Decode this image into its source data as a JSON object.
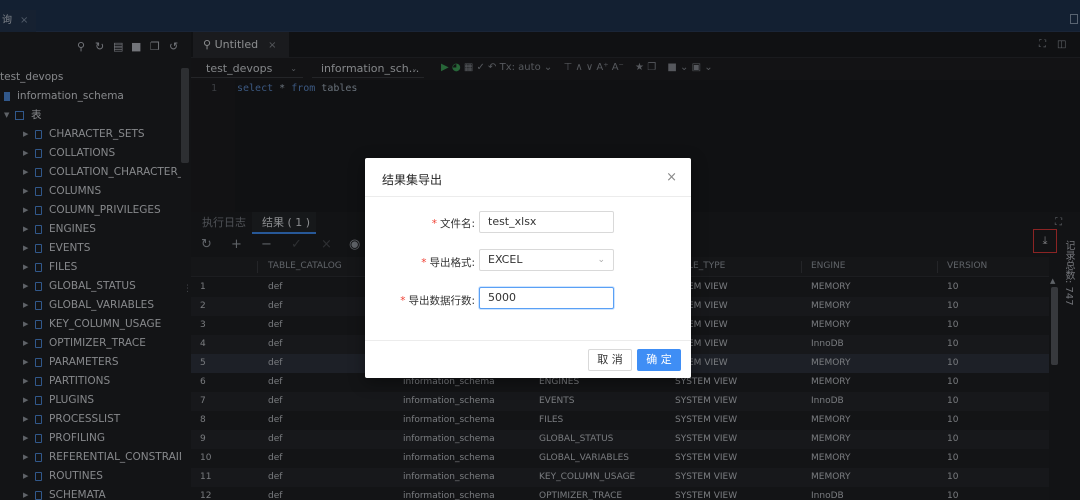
{
  "window": {
    "tab_label": "询",
    "tab_close": "×"
  },
  "sidebar": {
    "toolbar_icons": [
      "search-icon",
      "refresh-icon",
      "list-icon",
      "folder-icon",
      "copy-icon",
      "sync-icon"
    ],
    "database": "test_devops",
    "schema": "information_schema",
    "tables_group": "表",
    "tables": [
      "CHARACTER_SETS",
      "COLLATIONS",
      "COLLATION_CHARACTER_SE",
      "COLUMNS",
      "COLUMN_PRIVILEGES",
      "ENGINES",
      "EVENTS",
      "FILES",
      "GLOBAL_STATUS",
      "GLOBAL_VARIABLES",
      "KEY_COLUMN_USAGE",
      "OPTIMIZER_TRACE",
      "PARAMETERS",
      "PARTITIONS",
      "PLUGINS",
      "PROCESSLIST",
      "PROFILING",
      "REFERENTIAL_CONSTRAINTS",
      "ROUTINES",
      "SCHEMATA"
    ]
  },
  "editor": {
    "tab_title": "Untitled",
    "tab_close": "×",
    "db_select": "test_devops",
    "schema_select": "information_sch...",
    "tx_mode": "Tx: auto",
    "line_number": "1",
    "sql": {
      "kw1": "select",
      "star": " * ",
      "kw2": "from",
      "rest": " tables"
    }
  },
  "results": {
    "tab_log": "执行日志",
    "tab_result": "结果 ( 1 )",
    "record_count": "记录总数: 747",
    "columns": [
      "TABLE_CATALOG",
      "LE_TYPE",
      "ENGINE",
      "VERSION"
    ],
    "rows": [
      [
        "1",
        "def",
        "",
        "",
        "EM VIEW",
        "MEMORY",
        "10"
      ],
      [
        "2",
        "def",
        "",
        "",
        "EM VIEW",
        "MEMORY",
        "10"
      ],
      [
        "3",
        "def",
        "",
        "",
        "EM VIEW",
        "MEMORY",
        "10"
      ],
      [
        "4",
        "def",
        "",
        "",
        "EM VIEW",
        "InnoDB",
        "10"
      ],
      [
        "5",
        "def",
        "",
        "",
        "EM VIEW",
        "MEMORY",
        "10"
      ],
      [
        "6",
        "def",
        "information_schema",
        "ENGINES",
        "SYSTEM VIEW",
        "MEMORY",
        "10"
      ],
      [
        "7",
        "def",
        "information_schema",
        "EVENTS",
        "SYSTEM VIEW",
        "InnoDB",
        "10"
      ],
      [
        "8",
        "def",
        "information_schema",
        "FILES",
        "SYSTEM VIEW",
        "MEMORY",
        "10"
      ],
      [
        "9",
        "def",
        "information_schema",
        "GLOBAL_STATUS",
        "SYSTEM VIEW",
        "MEMORY",
        "10"
      ],
      [
        "10",
        "def",
        "information_schema",
        "GLOBAL_VARIABLES",
        "SYSTEM VIEW",
        "MEMORY",
        "10"
      ],
      [
        "11",
        "def",
        "information_schema",
        "KEY_COLUMN_USAGE",
        "SYSTEM VIEW",
        "MEMORY",
        "10"
      ],
      [
        "12",
        "def",
        "information_schema",
        "OPTIMIZER_TRACE",
        "SYSTEM VIEW",
        "InnoDB",
        "10"
      ]
    ]
  },
  "dialog": {
    "title": "结果集导出",
    "close": "×",
    "filename_label": "文件名:",
    "filename_value": "test_xlsx",
    "format_label": "导出格式:",
    "format_value": "EXCEL",
    "rows_label": "导出数据行数:",
    "rows_value": "5000",
    "required_mark": "*",
    "cancel_label": "取 消",
    "ok_label": "确 定"
  },
  "colors": {
    "accent": "#3f8ef5",
    "highlight": "#e03a3a",
    "background": "#1e1f22"
  }
}
